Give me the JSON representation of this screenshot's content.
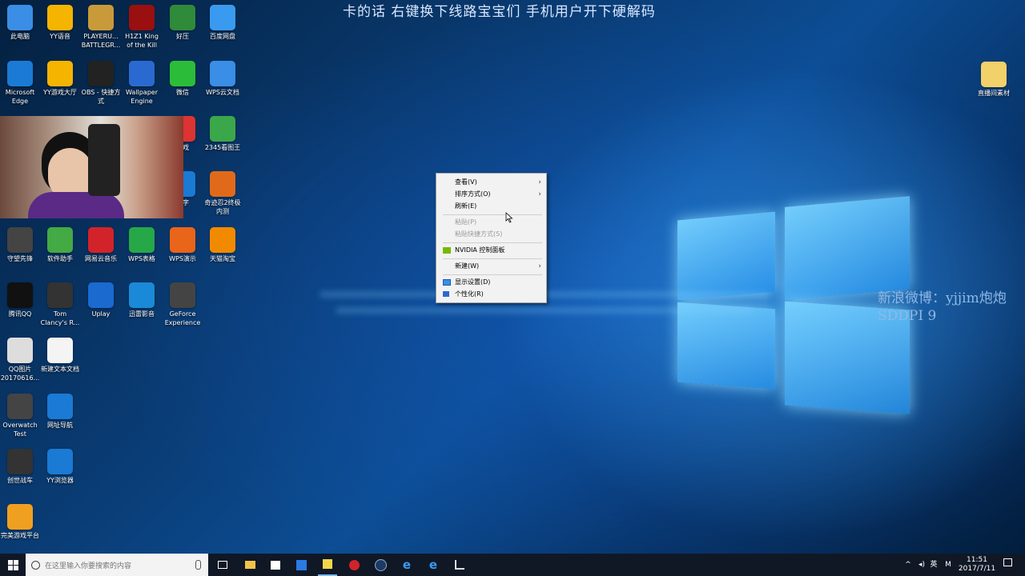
{
  "overlay": {
    "top_caption": "卡的话 右键换下线路宝宝们 手机用户开下硬解码",
    "weibo_line1": "新浪微博：yjjim炮炮",
    "weibo_line2": "SDDPI 9"
  },
  "desktop_icons": [
    {
      "label": "此电脑",
      "icon": "computer-icon",
      "color": "#3a8ee6"
    },
    {
      "label": "YY语音",
      "icon": "yy-icon",
      "color": "#f5b400"
    },
    {
      "label": "PLAYERU... BATTLEGR...",
      "icon": "pubg-icon",
      "color": "#c89a3a"
    },
    {
      "label": "H1Z1 King of the Kill",
      "icon": "h1z1-icon",
      "color": "#9a1010"
    },
    {
      "label": "好压",
      "icon": "archive-icon",
      "color": "#2f8a3a"
    },
    {
      "label": "百度网盘",
      "icon": "cloud-icon",
      "color": "#3a9af0"
    },
    {
      "label": "Microsoft Edge",
      "icon": "edge-icon",
      "color": "#1a7ad4"
    },
    {
      "label": "YY游戏大厅",
      "icon": "yy-game-icon",
      "color": "#f5b400"
    },
    {
      "label": "OBS - 快捷方式",
      "icon": "obs-icon",
      "color": "#222"
    },
    {
      "label": "Wallpaper Engine",
      "icon": "wallpaper-icon",
      "color": "#2a6ad0"
    },
    {
      "label": "微信",
      "icon": "wechat-icon",
      "color": "#2bbd3a"
    },
    {
      "label": "WPS云文档",
      "icon": "wps-cloud-icon",
      "color": "#3a8ee6"
    },
    {
      "label": "游戏",
      "icon": "qq-game-icon",
      "color": "#d33"
    },
    {
      "label": "2345看图王",
      "icon": "image-viewer-icon",
      "color": "#3aa84a"
    },
    {
      "label": "文字",
      "icon": "wps-writer-icon",
      "color": "#1a7ad4"
    },
    {
      "label": "奇迹忍2终极内测",
      "icon": "ninja-game-icon",
      "color": "#e06a1a"
    },
    {
      "label": "守望先锋",
      "icon": "overwatch-icon",
      "color": "#444"
    },
    {
      "label": "软件助手",
      "icon": "app-helper-icon",
      "color": "#4a4"
    },
    {
      "label": "网易云音乐",
      "icon": "netease-music-icon",
      "color": "#d2232a"
    },
    {
      "label": "WPS表格",
      "icon": "wps-sheet-icon",
      "color": "#26a848"
    },
    {
      "label": "WPS演示",
      "icon": "wps-slides-icon",
      "color": "#e8651a"
    },
    {
      "label": "天猫淘宝",
      "icon": "taobao-icon",
      "color": "#f28a00"
    },
    {
      "label": "腾讯QQ",
      "icon": "qq-icon",
      "color": "#111"
    },
    {
      "label": "Tom Clancy's R...",
      "icon": "rainbow-six-icon",
      "color": "#333"
    },
    {
      "label": "Uplay",
      "icon": "uplay-icon",
      "color": "#1a6ad0"
    },
    {
      "label": "迅雷影音",
      "icon": "xunlei-icon",
      "color": "#1a8ad8"
    },
    {
      "label": "GeForce Experience",
      "icon": "geforce-icon",
      "color": "#444"
    },
    {
      "label": "QQ图片 20170616...",
      "icon": "image-file-icon",
      "color": "#ddd"
    },
    {
      "label": "新建文本文档",
      "icon": "text-file-icon",
      "color": "#f4f4f4"
    },
    {
      "label": "Overwatch Test",
      "icon": "overwatch-test-icon",
      "color": "#444"
    },
    {
      "label": "网址导航",
      "icon": "ie-nav-icon",
      "color": "#1a7ad4"
    },
    {
      "label": "创世战车",
      "icon": "crossout-icon",
      "color": "#333"
    },
    {
      "label": "YY浏览器",
      "icon": "yy-browser-icon",
      "color": "#1a7ad4"
    },
    {
      "label": "完美游戏平台",
      "icon": "perfect-world-icon",
      "color": "#f0a020"
    },
    {
      "label": "直播间素材",
      "icon": "folder-icon",
      "color": "#f2d06a"
    }
  ],
  "context_menu": {
    "items": [
      {
        "label": "查看(V)",
        "submenu": true
      },
      {
        "label": "排序方式(O)",
        "submenu": true
      },
      {
        "label": "刷新(E)"
      },
      {
        "label": "粘贴(P)",
        "disabled": true
      },
      {
        "label": "粘贴快捷方式(S)",
        "disabled": true
      },
      {
        "label": "NVIDIA 控制面板"
      },
      {
        "label": "新建(W)",
        "submenu": true
      },
      {
        "label": "显示设置(D)"
      },
      {
        "label": "个性化(R)"
      }
    ]
  },
  "taskbar": {
    "search_placeholder": "在这里输入你要搜索的内容",
    "tray_lang": "英",
    "time": "11:51",
    "date": "2017/7/11"
  }
}
